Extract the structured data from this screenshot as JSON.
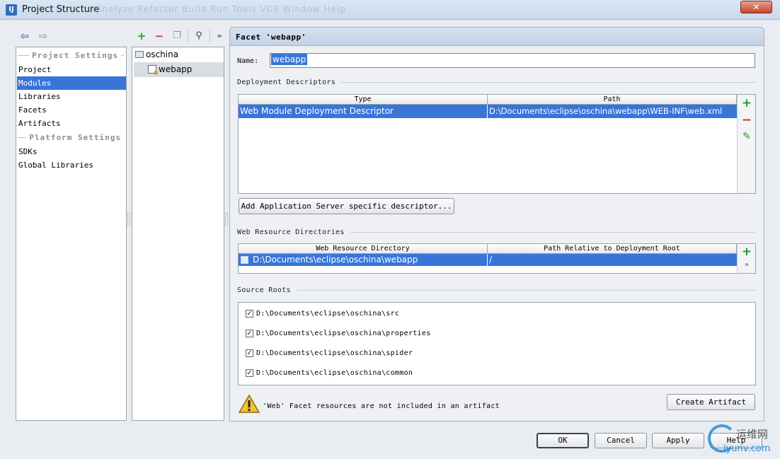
{
  "window": {
    "title": "Project Structure",
    "icon": "IJ",
    "ghost_menu": "Analyze   Refactor   Build   Run   Tools   VCS   Window   Help",
    "close": "✕"
  },
  "nav": {
    "project_settings_header": "Project Settings",
    "project_items": [
      "Project",
      "Modules",
      "Libraries",
      "Facets",
      "Artifacts"
    ],
    "platform_settings_header": "Platform Settings",
    "platform_items": [
      "SDKs",
      "Global Libraries"
    ]
  },
  "tree": {
    "root": "oschina",
    "child": "webapp"
  },
  "facet": {
    "title": "Facet 'webapp'",
    "name_label": "Name:",
    "name_value": "webapp",
    "deployment_label": "Deployment Descriptors",
    "dd_columns": [
      "Type",
      "Path"
    ],
    "dd_row": {
      "type": "Web Module Deployment Descriptor",
      "path": "D:\\Documents\\eclipse\\oschina\\webapp\\WEB-INF\\web.xml"
    },
    "add_server_descriptor": "Add Application Server specific descriptor...",
    "web_resource_label": "Web Resource Directories",
    "wr_columns": [
      "Web Resource Directory",
      "Path Relative to Deployment Root"
    ],
    "wr_row": {
      "directory": "D:\\Documents\\eclipse\\oschina\\webapp",
      "relative": "/"
    },
    "source_roots_label": "Source Roots",
    "source_roots": [
      "D:\\Documents\\eclipse\\oschina\\src",
      "D:\\Documents\\eclipse\\oschina\\properties",
      "D:\\Documents\\eclipse\\oschina\\spider",
      "D:\\Documents\\eclipse\\oschina\\common"
    ],
    "warning_text": "'Web' Facet resources are not included in an artifact",
    "create_artifact": "Create Artifact"
  },
  "footer": {
    "ok": "OK",
    "cancel": "Cancel",
    "apply": "Apply",
    "help": "Help"
  },
  "watermark": {
    "line1": "运维网",
    "line2": "iyunv.com"
  },
  "colors": {
    "selection": "#3875d7",
    "add_green": "#2e9a2e",
    "remove_red": "#d03020"
  }
}
